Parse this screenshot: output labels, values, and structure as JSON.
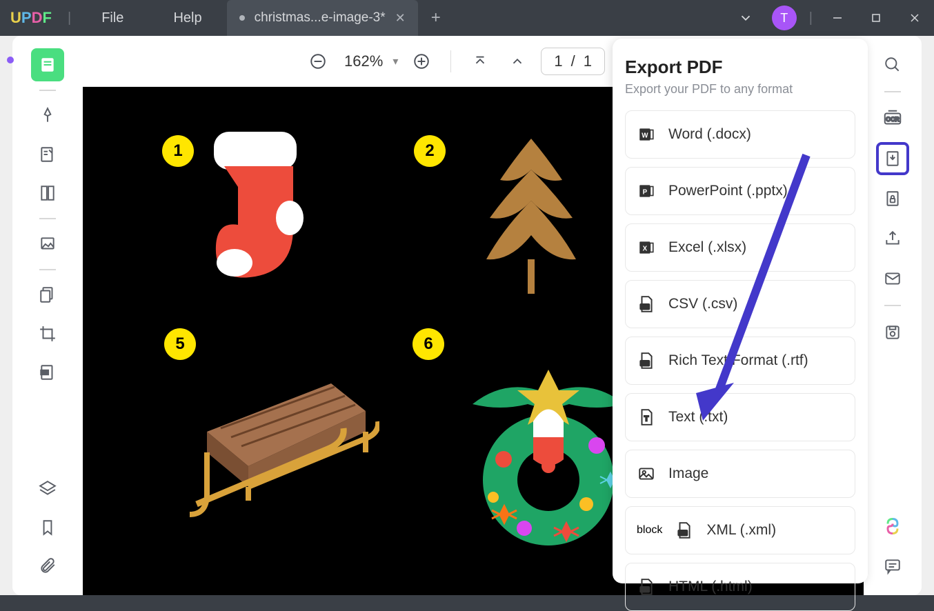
{
  "app": {
    "logo": {
      "u": "U",
      "p": "P",
      "d": "D",
      "f": "F"
    }
  },
  "menu": {
    "file": "File",
    "help": "Help"
  },
  "tab": {
    "title": "christmas...e-image-3*"
  },
  "toolbar": {
    "zoom": "162%",
    "page_current": "1",
    "page_sep": "/",
    "page_total": "1"
  },
  "export": {
    "title": "Export PDF",
    "subtitle": "Export your PDF to any format",
    "items": [
      {
        "label": "Word (.docx)"
      },
      {
        "label": "PowerPoint (.pptx)"
      },
      {
        "label": "Excel (.xlsx)"
      },
      {
        "label": "CSV (.csv)"
      },
      {
        "label": "Rich Text Format (.rtf)"
      },
      {
        "label": "Text (.txt)"
      },
      {
        "label": "Image"
      },
      {
        "label": "XML (.xml)"
      },
      {
        "label": "HTML (.html)"
      }
    ]
  },
  "badges": {
    "n1": "1",
    "n2": "2",
    "n5": "5",
    "n6": "6"
  },
  "avatar": "T"
}
